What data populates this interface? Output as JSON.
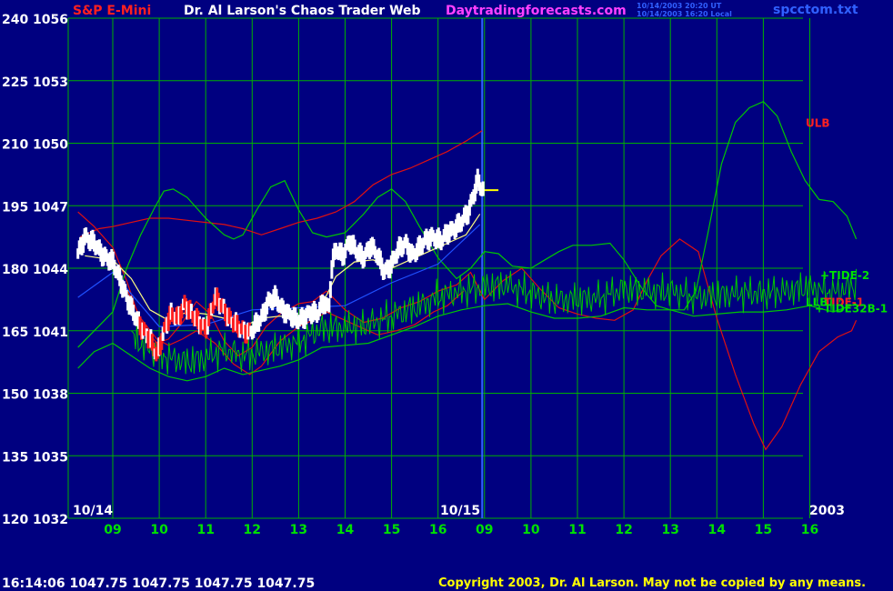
{
  "header": {
    "title_left": "S&P E-Mini",
    "title_center": "Dr. Al Larson's Chaos Trader Web",
    "site": "Daytradingforecasts.com",
    "stamp_line1": "10/14/2003 20:20 UT",
    "stamp_line2": "10/14/2003 16:20 Local",
    "filename": "spcctom.txt"
  },
  "footer": {
    "quote": "16:14:06  1047.75 1047.75 1047.75 1047.75",
    "copyright": "Copyright 2003, Dr. Al Larson. May not be copied by any means."
  },
  "colors": {
    "background": "#000080",
    "grid": "#00b000",
    "price_up": "#ffffff",
    "price_down": "#ff2020",
    "tide": "#00c800",
    "band": "#e01010",
    "channel": "#2050ff",
    "cursor": "#ffff00",
    "title_left": "#ff2020",
    "title_center": "#ffffff",
    "site": "#ff40ff",
    "stamp": "#3060ff"
  },
  "chart_data": {
    "type": "line",
    "y_left_labels": [
      "240",
      "225",
      "210",
      "195",
      "180",
      "165",
      "150",
      "135",
      "120"
    ],
    "y_price_labels": [
      "1056",
      "1053",
      "1050",
      "1047",
      "1044",
      "1041",
      "1038",
      "1035",
      "1032"
    ],
    "ylim": [
      1032,
      1056
    ],
    "x_hours": [
      "09",
      "10",
      "11",
      "12",
      "13",
      "14",
      "15",
      "16",
      "09",
      "10",
      "11",
      "12",
      "13",
      "14",
      "15",
      "16"
    ],
    "date_labels": [
      "10/14",
      "10/15"
    ],
    "year_label": "2003",
    "day_divider_hour": 8,
    "series_labels": [
      {
        "text": "ULB",
        "color": "#ff2020",
        "value": 1051.0
      },
      {
        "text": "+TIDE-2",
        "color": "#00e000",
        "value": 1043.7
      },
      {
        "text": "LLB",
        "color": "#00e000",
        "value": 1042.4
      },
      {
        "text": "TIDE-1",
        "color": "#ff2020",
        "value": 1042.4
      },
      {
        "text": "+TIDE32B-1",
        "color": "#00e000",
        "value": 1042.1
      }
    ],
    "series": [
      {
        "name": "TIDE-1",
        "color": "#e01010",
        "points": [
          [
            -0.75,
            1046.7
          ],
          [
            -0.4,
            1046.0
          ],
          [
            0,
            1045.0
          ],
          [
            0.3,
            1043.4
          ],
          [
            0.6,
            1041.4
          ],
          [
            0.95,
            1040.4
          ],
          [
            1.2,
            1040.6
          ],
          [
            1.5,
            1041.4
          ],
          [
            1.8,
            1042.4
          ],
          [
            2.1,
            1041.8
          ],
          [
            2.4,
            1040.5
          ],
          [
            2.7,
            1039.8
          ],
          [
            3.0,
            1040.2
          ],
          [
            3.3,
            1041.2
          ],
          [
            3.6,
            1041.8
          ],
          [
            4.0,
            1042.3
          ],
          [
            4.3,
            1042.4
          ],
          [
            4.6,
            1042.9
          ],
          [
            5.0,
            1042.0
          ],
          [
            5.4,
            1041.4
          ],
          [
            5.8,
            1041.6
          ],
          [
            6.2,
            1042.1
          ],
          [
            6.6,
            1042.4
          ],
          [
            7.0,
            1042.9
          ],
          [
            7.4,
            1043.2
          ],
          [
            7.7,
            1043.8
          ],
          [
            8.0,
            1042.5
          ],
          [
            8.4,
            1043.4
          ],
          [
            8.8,
            1044.0
          ],
          [
            9.2,
            1043.0
          ],
          [
            9.6,
            1042.1
          ],
          [
            10.0,
            1041.8
          ],
          [
            10.4,
            1041.6
          ],
          [
            10.8,
            1041.5
          ],
          [
            11.2,
            1042.0
          ],
          [
            11.5,
            1043.4
          ],
          [
            11.8,
            1044.6
          ],
          [
            12.2,
            1045.4
          ],
          [
            12.6,
            1044.8
          ],
          [
            13.0,
            1041.6
          ],
          [
            13.4,
            1038.9
          ],
          [
            13.8,
            1036.5
          ],
          [
            14.05,
            1035.3
          ],
          [
            14.4,
            1036.4
          ],
          [
            14.8,
            1038.4
          ],
          [
            15.2,
            1040.0
          ],
          [
            15.6,
            1040.7
          ],
          [
            15.9,
            1041.0
          ],
          [
            16.0,
            1041.5
          ]
        ]
      },
      {
        "name": "ULB",
        "color": "#e01010",
        "points": [
          [
            -0.7,
            1045.5
          ],
          [
            -0.3,
            1045.9
          ],
          [
            0,
            1046.0
          ],
          [
            0.4,
            1046.2
          ],
          [
            0.8,
            1046.4
          ],
          [
            1.2,
            1046.4
          ],
          [
            1.6,
            1046.3
          ],
          [
            2.0,
            1046.2
          ],
          [
            2.4,
            1046.1
          ],
          [
            2.8,
            1045.9
          ],
          [
            3.2,
            1045.6
          ],
          [
            3.6,
            1045.9
          ],
          [
            4.0,
            1046.2
          ],
          [
            4.4,
            1046.4
          ],
          [
            4.8,
            1046.7
          ],
          [
            5.2,
            1047.2
          ],
          [
            5.6,
            1048.0
          ],
          [
            6.0,
            1048.5
          ],
          [
            6.4,
            1048.8
          ],
          [
            6.8,
            1049.2
          ],
          [
            7.2,
            1049.6
          ],
          [
            7.6,
            1050.1
          ],
          [
            7.95,
            1050.6
          ]
        ]
      },
      {
        "name": "LLB",
        "color": "#e01010",
        "points": [
          [
            0.3,
            1043.0
          ],
          [
            0.6,
            1041.6
          ],
          [
            0.95,
            1040.6
          ],
          [
            1.2,
            1040.3
          ],
          [
            1.5,
            1040.6
          ],
          [
            1.8,
            1041.0
          ],
          [
            2.2,
            1040.4
          ],
          [
            2.6,
            1039.4
          ],
          [
            2.95,
            1038.9
          ],
          [
            3.2,
            1039.3
          ],
          [
            3.6,
            1040.5
          ],
          [
            4.0,
            1041.2
          ],
          [
            4.3,
            1041.5
          ],
          [
            4.6,
            1041.9
          ],
          [
            5.0,
            1041.5
          ],
          [
            5.3,
            1041.2
          ],
          [
            5.7,
            1040.8
          ],
          [
            6.1,
            1041.0
          ],
          [
            6.5,
            1041.3
          ],
          [
            6.9,
            1041.9
          ],
          [
            7.2,
            1042.2
          ],
          [
            7.55,
            1042.9
          ]
        ]
      },
      {
        "name": "TIDE-2",
        "color": "#00c800",
        "points": [
          [
            -0.75,
            1040.2
          ],
          [
            -0.4,
            1041.0
          ],
          [
            0,
            1041.9
          ],
          [
            0.3,
            1044.0
          ],
          [
            0.6,
            1045.6
          ],
          [
            0.9,
            1046.9
          ],
          [
            1.1,
            1047.7
          ],
          [
            1.3,
            1047.8
          ],
          [
            1.6,
            1047.4
          ],
          [
            2.0,
            1046.4
          ],
          [
            2.4,
            1045.6
          ],
          [
            2.6,
            1045.4
          ],
          [
            2.8,
            1045.6
          ],
          [
            3.1,
            1046.8
          ],
          [
            3.4,
            1047.9
          ],
          [
            3.7,
            1048.2
          ],
          [
            4.0,
            1046.8
          ],
          [
            4.3,
            1045.7
          ],
          [
            4.6,
            1045.5
          ],
          [
            5.0,
            1045.7
          ],
          [
            5.4,
            1046.6
          ],
          [
            5.7,
            1047.4
          ],
          [
            6.0,
            1047.8
          ],
          [
            6.3,
            1047.2
          ],
          [
            6.6,
            1046.0
          ],
          [
            7.0,
            1044.5
          ],
          [
            7.4,
            1043.5
          ],
          [
            7.7,
            1044.0
          ],
          [
            8.0,
            1044.8
          ],
          [
            8.3,
            1044.7
          ],
          [
            8.6,
            1044.1
          ],
          [
            9.0,
            1044.0
          ],
          [
            9.3,
            1044.4
          ],
          [
            9.6,
            1044.8
          ],
          [
            9.9,
            1045.1
          ],
          [
            10.3,
            1045.1
          ],
          [
            10.7,
            1045.2
          ],
          [
            11.0,
            1044.4
          ],
          [
            11.4,
            1043.0
          ],
          [
            11.7,
            1042.2
          ],
          [
            12.0,
            1042.0
          ],
          [
            12.3,
            1042.0
          ],
          [
            12.55,
            1042.9
          ],
          [
            12.8,
            1045.6
          ],
          [
            13.1,
            1049.0
          ],
          [
            13.4,
            1051.0
          ],
          [
            13.7,
            1051.7
          ],
          [
            14.0,
            1052.0
          ],
          [
            14.3,
            1051.3
          ],
          [
            14.6,
            1049.6
          ],
          [
            14.9,
            1048.2
          ],
          [
            15.2,
            1047.3
          ],
          [
            15.5,
            1047.2
          ],
          [
            15.8,
            1046.5
          ],
          [
            16.0,
            1045.4
          ]
        ]
      },
      {
        "name": "TIDE32B-1",
        "color": "#00c800",
        "points": [
          [
            -0.75,
            1039.2
          ],
          [
            -0.4,
            1040.0
          ],
          [
            0,
            1040.4
          ],
          [
            0.4,
            1039.8
          ],
          [
            0.8,
            1039.2
          ],
          [
            1.2,
            1038.8
          ],
          [
            1.6,
            1038.6
          ],
          [
            2.0,
            1038.8
          ],
          [
            2.4,
            1039.2
          ],
          [
            2.8,
            1038.9
          ],
          [
            3.2,
            1039.1
          ],
          [
            3.6,
            1039.3
          ],
          [
            4.0,
            1039.6
          ],
          [
            4.5,
            1040.2
          ],
          [
            5.0,
            1040.3
          ],
          [
            5.5,
            1040.4
          ],
          [
            6.0,
            1040.8
          ],
          [
            6.5,
            1041.2
          ],
          [
            7.0,
            1041.7
          ],
          [
            7.5,
            1042.0
          ],
          [
            8.0,
            1042.2
          ],
          [
            8.5,
            1042.3
          ],
          [
            9.0,
            1041.9
          ],
          [
            9.5,
            1041.6
          ],
          [
            10.0,
            1041.6
          ],
          [
            10.5,
            1041.7
          ],
          [
            11.0,
            1042.1
          ],
          [
            11.5,
            1042.0
          ],
          [
            12.0,
            1042.0
          ],
          [
            12.5,
            1041.7
          ],
          [
            13.0,
            1041.8
          ],
          [
            13.5,
            1041.9
          ],
          [
            14.0,
            1041.9
          ],
          [
            14.5,
            1042.0
          ],
          [
            15.0,
            1042.2
          ],
          [
            15.5,
            1041.9
          ],
          [
            16.0,
            1042.3
          ]
        ]
      },
      {
        "name": "channel",
        "color": "#2050ff",
        "points": [
          [
            -0.75,
            1042.6
          ],
          [
            0,
            1043.8
          ],
          [
            1.0,
            1041.2
          ],
          [
            2.0,
            1041.3
          ],
          [
            3.0,
            1042.0
          ],
          [
            4.0,
            1042.1
          ],
          [
            5.0,
            1042.2
          ],
          [
            6.0,
            1043.3
          ],
          [
            7.0,
            1044.2
          ],
          [
            7.9,
            1046.1
          ]
        ]
      },
      {
        "name": "price_ma",
        "color": "#ffff80",
        "points": [
          [
            -0.6,
            1044.6
          ],
          [
            0,
            1044.4
          ],
          [
            0.4,
            1043.5
          ],
          [
            0.8,
            1042.0
          ],
          [
            1.2,
            1041.5
          ],
          [
            1.6,
            1041.9
          ],
          [
            2.0,
            1041.8
          ],
          [
            2.4,
            1041.6
          ],
          [
            2.8,
            1041.2
          ],
          [
            3.2,
            1041.6
          ],
          [
            3.6,
            1041.7
          ],
          [
            4.0,
            1041.6
          ],
          [
            4.4,
            1041.8
          ],
          [
            4.8,
            1043.6
          ],
          [
            5.2,
            1044.3
          ],
          [
            5.6,
            1044.4
          ],
          [
            6.0,
            1044.0
          ],
          [
            6.4,
            1044.4
          ],
          [
            6.8,
            1044.8
          ],
          [
            7.2,
            1045.2
          ],
          [
            7.6,
            1045.6
          ],
          [
            7.9,
            1046.6
          ]
        ]
      },
      {
        "name": "close_line",
        "color": "#ffff00",
        "points": [
          [
            7.95,
            1047.75
          ],
          [
            8.3,
            1047.75
          ]
        ]
      }
    ],
    "price_path": [
      [
        -0.75,
        1044.7
      ],
      [
        -0.6,
        1045.5
      ],
      [
        -0.4,
        1045.2
      ],
      [
        -0.2,
        1044.6
      ],
      [
        0,
        1044.3
      ],
      [
        0.15,
        1043.5
      ],
      [
        0.3,
        1042.6
      ],
      [
        0.45,
        1041.8
      ],
      [
        0.6,
        1041.2
      ],
      [
        0.8,
        1040.6
      ],
      [
        0.95,
        1039.8
      ],
      [
        1.05,
        1040.6
      ],
      [
        1.15,
        1041.3
      ],
      [
        1.25,
        1041.8
      ],
      [
        1.4,
        1041.6
      ],
      [
        1.55,
        1042.3
      ],
      [
        1.7,
        1041.8
      ],
      [
        1.85,
        1041.4
      ],
      [
        2.0,
        1041.1
      ],
      [
        2.1,
        1041.8
      ],
      [
        2.2,
        1042.6
      ],
      [
        2.35,
        1042.2
      ],
      [
        2.5,
        1041.6
      ],
      [
        2.65,
        1041.3
      ],
      [
        2.8,
        1041.0
      ],
      [
        2.95,
        1040.9
      ],
      [
        3.05,
        1041.2
      ],
      [
        3.2,
        1041.6
      ],
      [
        3.35,
        1042.4
      ],
      [
        3.5,
        1042.6
      ],
      [
        3.65,
        1042.0
      ],
      [
        3.8,
        1041.8
      ],
      [
        3.95,
        1041.5
      ],
      [
        4.1,
        1041.6
      ],
      [
        4.25,
        1041.9
      ],
      [
        4.4,
        1041.8
      ],
      [
        4.55,
        1042.4
      ],
      [
        4.65,
        1042.0
      ],
      [
        4.72,
        1044.2
      ],
      [
        4.8,
        1044.9
      ],
      [
        4.95,
        1044.6
      ],
      [
        5.1,
        1045.3
      ],
      [
        5.25,
        1044.8
      ],
      [
        5.4,
        1044.5
      ],
      [
        5.55,
        1045.1
      ],
      [
        5.7,
        1044.6
      ],
      [
        5.85,
        1043.8
      ],
      [
        6.0,
        1044.2
      ],
      [
        6.15,
        1044.9
      ],
      [
        6.3,
        1045.2
      ],
      [
        6.45,
        1044.6
      ],
      [
        6.6,
        1045.0
      ],
      [
        6.75,
        1045.4
      ],
      [
        6.9,
        1045.5
      ],
      [
        7.05,
        1045.3
      ],
      [
        7.2,
        1045.7
      ],
      [
        7.35,
        1045.9
      ],
      [
        7.5,
        1046.2
      ],
      [
        7.65,
        1046.7
      ],
      [
        7.75,
        1047.4
      ],
      [
        7.85,
        1048.2
      ],
      [
        7.92,
        1047.9
      ],
      [
        7.97,
        1047.75
      ]
    ],
    "down_segments": [
      [
        0.55,
        2.95
      ]
    ]
  }
}
